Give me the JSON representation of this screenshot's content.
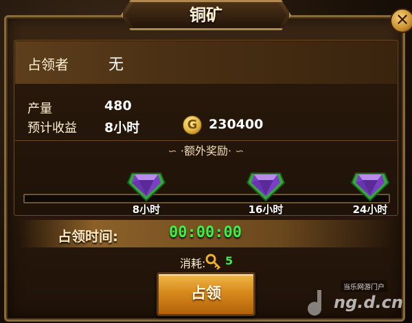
{
  "dialog": {
    "title": "铜矿",
    "close_icon": "close-x-icon"
  },
  "owner": {
    "label": "占领者",
    "value": "无"
  },
  "stats": {
    "output_label": "产量",
    "output_value": "480",
    "income_label": "预计收益",
    "income_duration": "8小时",
    "income_amount": "230400",
    "coin_glyph": "G"
  },
  "bonus": {
    "title": "·额外奖励·",
    "milestones": [
      {
        "label": "8小时",
        "icon": "purple-gem-icon"
      },
      {
        "label": "16小时",
        "icon": "purple-gem-icon"
      },
      {
        "label": "24小时",
        "icon": "purple-gem-icon"
      }
    ],
    "progress": 0
  },
  "occupy_time": {
    "label": "占领时间:",
    "value": "00:00:00"
  },
  "cost": {
    "label": "消耗:",
    "icon": "key-icon",
    "value": "5"
  },
  "occupy_button": {
    "label": "占领"
  },
  "watermark": {
    "site_name": "当乐网游门户",
    "logo_text": "ng.d.cn"
  },
  "colors": {
    "accent_green": "#3cf04a",
    "panel_border": "#8a6a3a",
    "button_gold": "#d88a1c"
  }
}
